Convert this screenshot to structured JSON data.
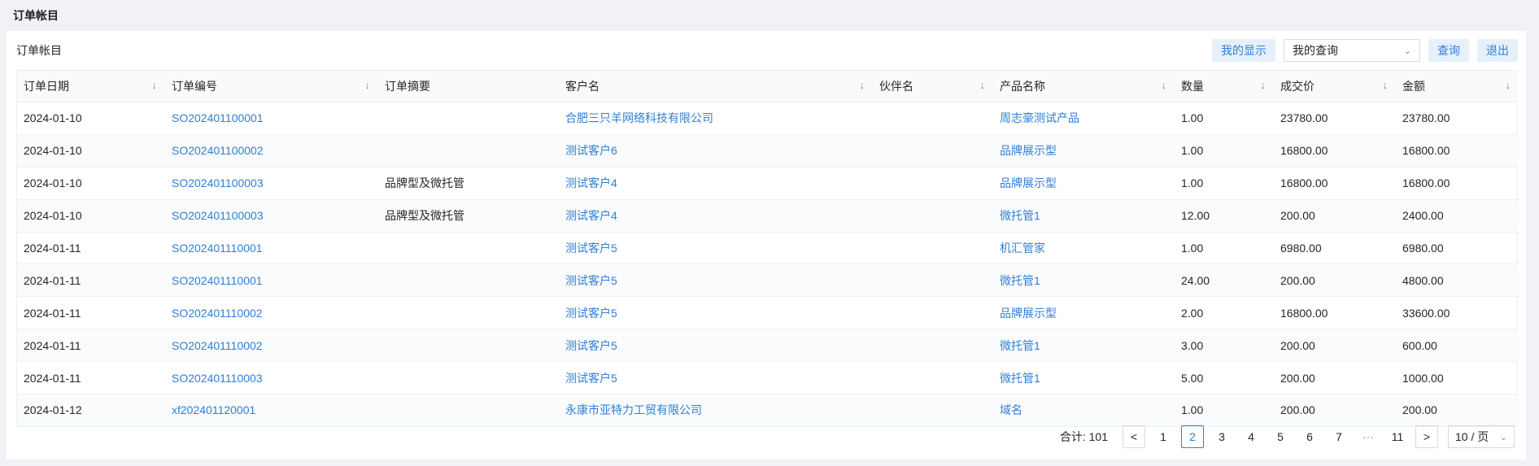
{
  "page": {
    "title": "订单帐目"
  },
  "panel": {
    "title": "订单帐目",
    "buttons": {
      "my_display": "我的显示",
      "query": "查询",
      "exit": "退出"
    },
    "query_select": {
      "value": "我的查询"
    }
  },
  "table": {
    "columns": [
      "订单日期",
      "订单编号",
      "订单摘要",
      "客户名",
      "伙伴名",
      "产品名称",
      "数量",
      "成交价",
      "金额"
    ],
    "rows": [
      [
        "2024-01-10",
        "SO202401100001",
        "",
        "合肥三只羊网络科技有限公司",
        "",
        "周志豪测试产品",
        "1.00",
        "23780.00",
        "23780.00"
      ],
      [
        "2024-01-10",
        "SO202401100002",
        "",
        "测试客户6",
        "",
        "品牌展示型",
        "1.00",
        "16800.00",
        "16800.00"
      ],
      [
        "2024-01-10",
        "SO202401100003",
        "品牌型及微托管",
        "测试客户4",
        "",
        "品牌展示型",
        "1.00",
        "16800.00",
        "16800.00"
      ],
      [
        "2024-01-10",
        "SO202401100003",
        "品牌型及微托管",
        "测试客户4",
        "",
        "微托管1",
        "12.00",
        "200.00",
        "2400.00"
      ],
      [
        "2024-01-11",
        "SO202401110001",
        "",
        "测试客户5",
        "",
        "机汇管家",
        "1.00",
        "6980.00",
        "6980.00"
      ],
      [
        "2024-01-11",
        "SO202401110001",
        "",
        "测试客户5",
        "",
        "微托管1",
        "24.00",
        "200.00",
        "4800.00"
      ],
      [
        "2024-01-11",
        "SO202401110002",
        "",
        "测试客户5",
        "",
        "品牌展示型",
        "2.00",
        "16800.00",
        "33600.00"
      ],
      [
        "2024-01-11",
        "SO202401110002",
        "",
        "测试客户5",
        "",
        "微托管1",
        "3.00",
        "200.00",
        "600.00"
      ],
      [
        "2024-01-11",
        "SO202401110003",
        "",
        "测试客户5",
        "",
        "微托管1",
        "5.00",
        "200.00",
        "1000.00"
      ],
      [
        "2024-01-12",
        "xf202401120001",
        "",
        "永康市亚特力工贸有限公司",
        "",
        "域名",
        "1.00",
        "200.00",
        "200.00"
      ]
    ]
  },
  "pagination": {
    "total_label": "合计:",
    "total": "101",
    "prev": "<",
    "next": ">",
    "pages": [
      "1",
      "2",
      "3",
      "4",
      "5",
      "6",
      "7",
      "···",
      "11"
    ],
    "current": "2",
    "page_size": "10 / 页"
  },
  "icons": {
    "sort": "sort-down-icon",
    "chevron": "chevron-down-icon"
  },
  "colors": {
    "link": "#2f7fd6",
    "soft_button_bg": "#e6f0fb",
    "background": "#f0f2f5"
  }
}
